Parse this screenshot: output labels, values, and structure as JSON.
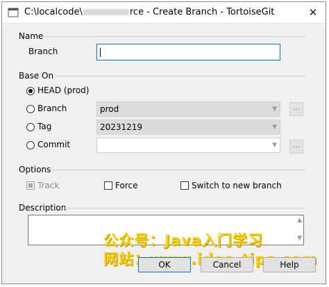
{
  "window": {
    "title_prefix": "C:\\localcode\\",
    "title_suffix": "rce - Create Branch - TortoiseGit",
    "close_glyph": "✕"
  },
  "name_group": {
    "label": "Name",
    "branch_label": "Branch",
    "branch_value": ""
  },
  "base_on": {
    "label": "Base On",
    "head_label": "HEAD (prod)",
    "branch_label": "Branch",
    "branch_value": "prod",
    "tag_label": "Tag",
    "tag_value": "20231219",
    "commit_label": "Commit",
    "commit_value": "",
    "ellipsis": "...",
    "combo_arrow": "▼",
    "selected": "HEAD"
  },
  "options": {
    "label": "Options",
    "track_label": "Track",
    "force_label": "Force",
    "switch_label": "Switch to new branch"
  },
  "description": {
    "label": "Description",
    "value": "",
    "scroll_up": "▲",
    "scroll_down": "▼"
  },
  "buttons": {
    "ok": "OK",
    "cancel": "Cancel",
    "help": "Help"
  },
  "watermark": {
    "line1": "公众号：Java入门学习",
    "line2": "网站：www.idea-tips.com"
  },
  "colors": {
    "accent": "#0078d7",
    "watermark": "#ffd000"
  },
  "icons": {
    "app": "tortoisegit-icon",
    "close": "close-icon"
  }
}
